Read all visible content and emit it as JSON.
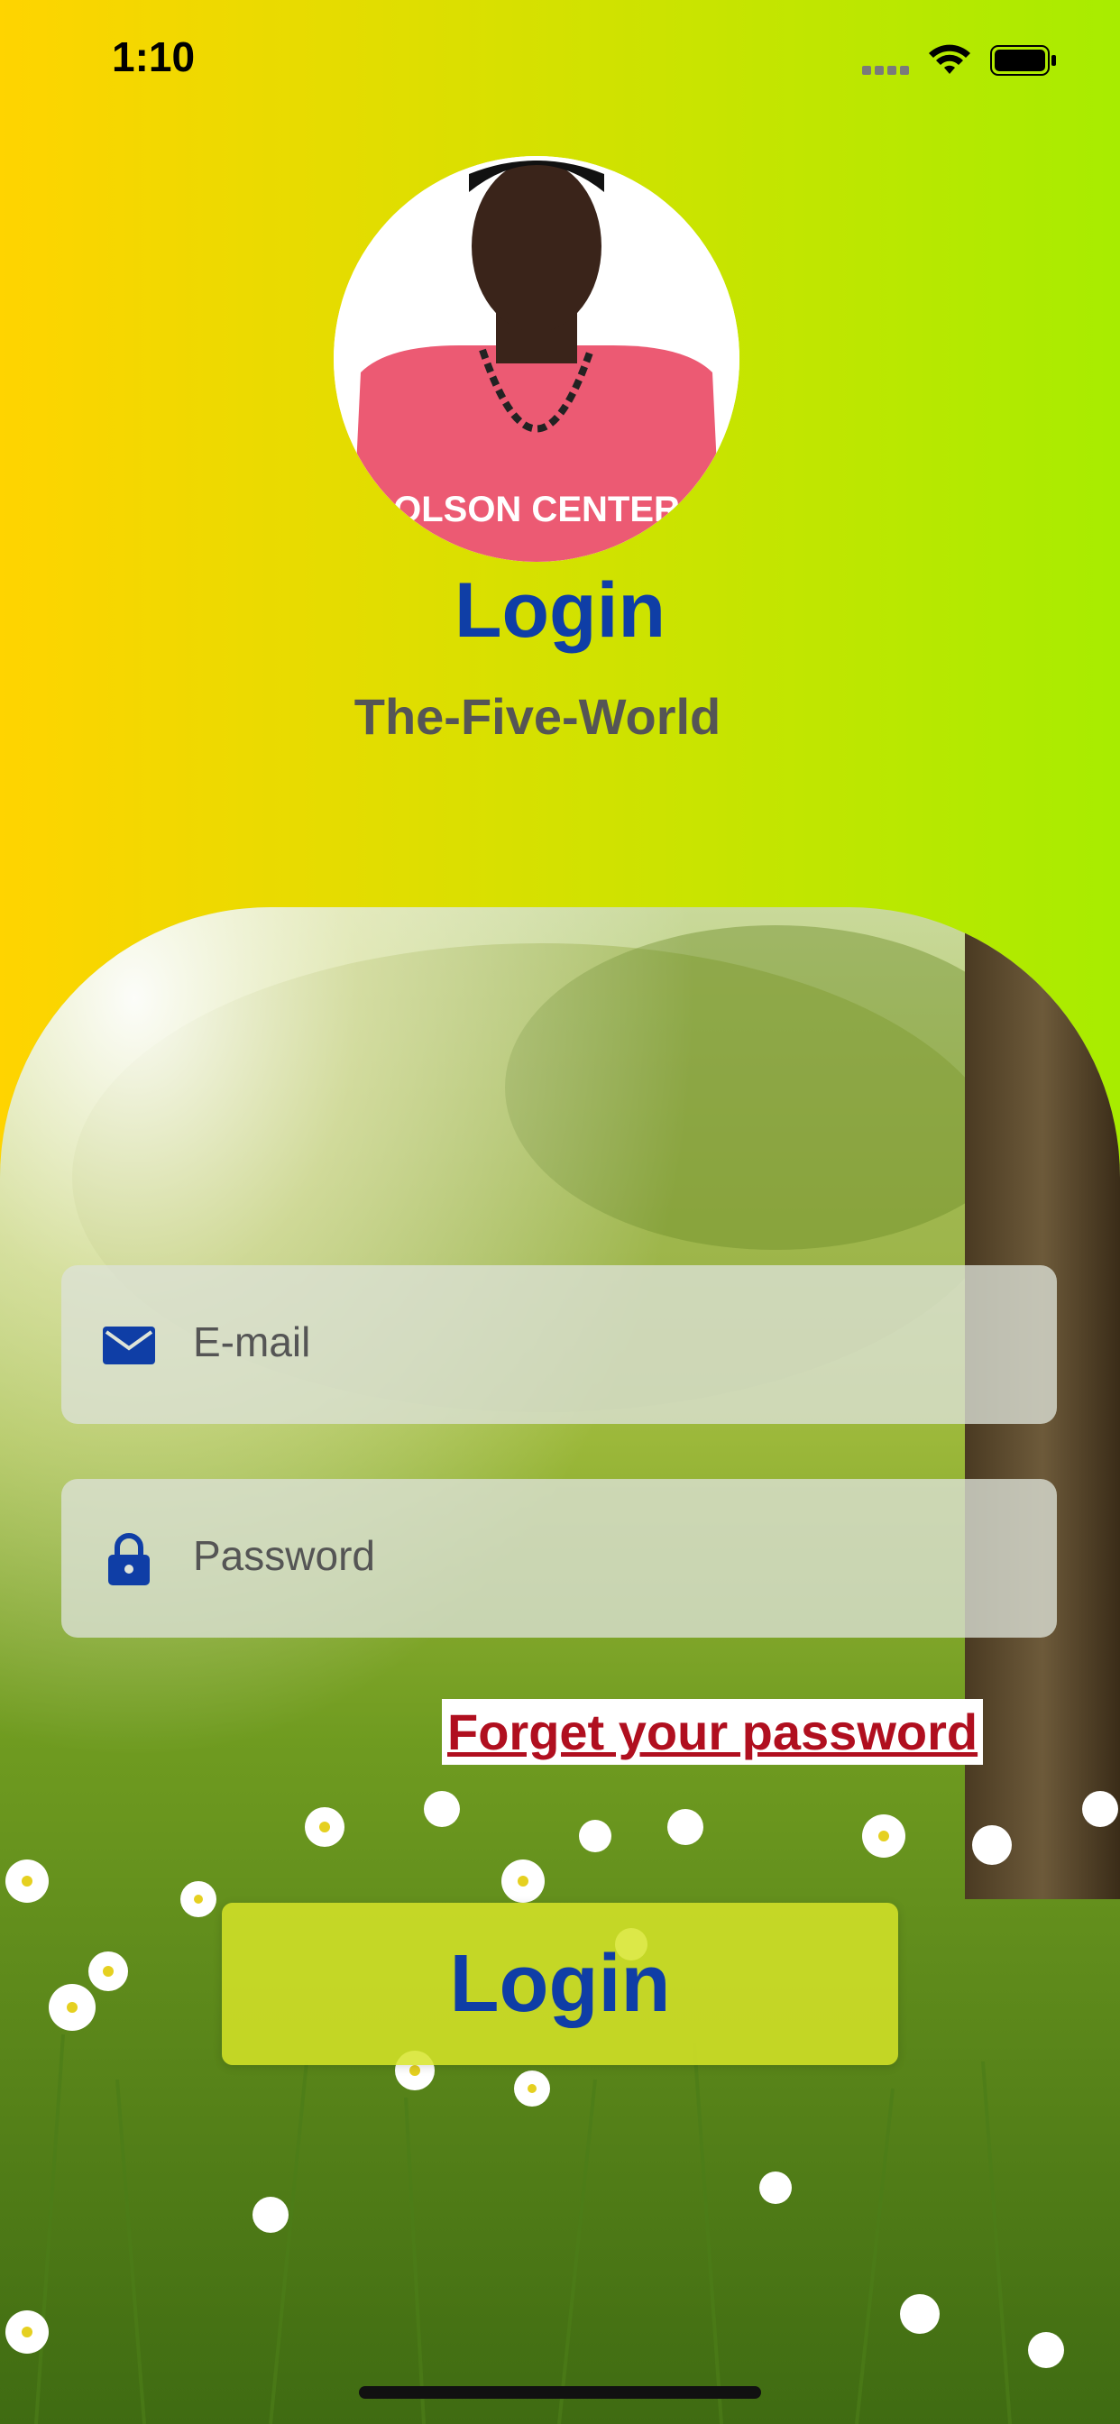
{
  "status_bar": {
    "time": "1:10"
  },
  "header": {
    "title": "Login",
    "subtitle": "The-Five-World",
    "avatar_shirt_text": "OLSON CENTER"
  },
  "form": {
    "email_placeholder": "E-mail",
    "password_placeholder": "Password",
    "forgot_label": "Forget your password",
    "login_button_label": "Login"
  },
  "icons": {
    "email": "mail-icon",
    "password": "lock-icon",
    "wifi": "wifi-icon",
    "battery": "battery-icon"
  },
  "colors": {
    "accent_blue": "#0f3ea6",
    "link_red": "#b00f1f",
    "gradient_start": "#ffd400",
    "gradient_end": "#a8ec00"
  }
}
